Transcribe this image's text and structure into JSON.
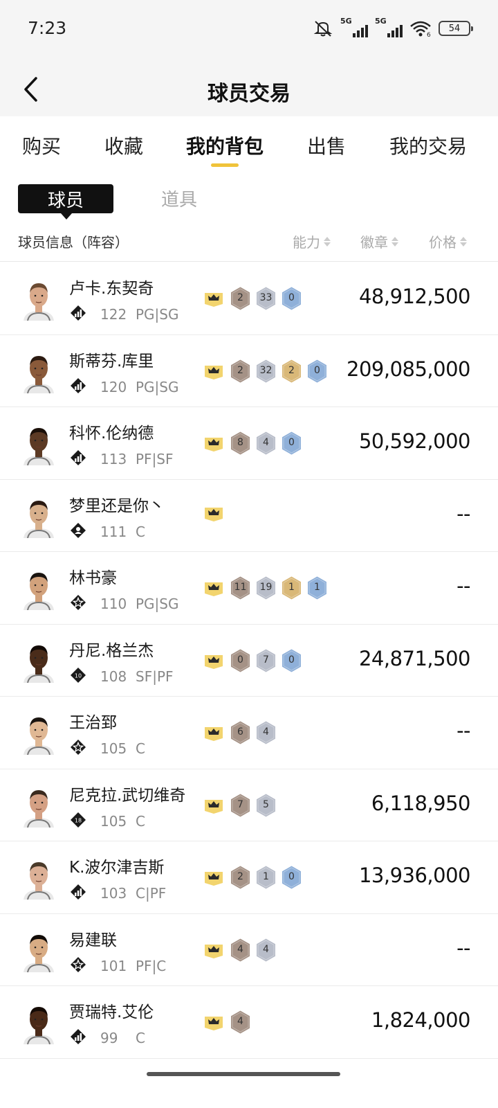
{
  "status": {
    "time": "7:23",
    "signal1": "5G",
    "signal2": "5G",
    "wifi_sub": "6",
    "battery": "54"
  },
  "header": {
    "title": "球员交易"
  },
  "tabs": [
    {
      "label": "购买"
    },
    {
      "label": "收藏"
    },
    {
      "label": "我的背包",
      "active": true
    },
    {
      "label": "出售"
    },
    {
      "label": "我的交易"
    }
  ],
  "subtabs": {
    "active": "球员",
    "other": "道具"
  },
  "columns": {
    "info": "球员信息（阵容）",
    "ability": "能力",
    "badge": "徽章",
    "price": "价格"
  },
  "colors": {
    "accent": "#f0c33a",
    "bronze": "#a59286",
    "silver": "#b8bdc9",
    "gold": "#d9b878",
    "blue": "#8fb0d9",
    "crown": "#f2d46e"
  },
  "players": [
    {
      "name": "卢卡.东契奇",
      "tier_icon": "bars-icon",
      "rating": "122",
      "position": "PG|SG",
      "skin": "#d9a98a",
      "hair": "#6b4a32",
      "badges": [
        {
          "type": "bronze",
          "value": "2"
        },
        {
          "type": "silver",
          "value": "33"
        },
        {
          "type": "blue",
          "value": "0"
        }
      ],
      "price": "48,912,500"
    },
    {
      "name": "斯蒂芬.库里",
      "tier_icon": "bars-icon",
      "rating": "120",
      "position": "PG|SG",
      "skin": "#8a5a3a",
      "hair": "#2b1a10",
      "badges": [
        {
          "type": "bronze",
          "value": "2"
        },
        {
          "type": "silver",
          "value": "32"
        },
        {
          "type": "gold",
          "value": "2"
        },
        {
          "type": "blue",
          "value": "0"
        }
      ],
      "price": "209,085,000"
    },
    {
      "name": "科怀.伦纳德",
      "tier_icon": "bars-icon",
      "rating": "113",
      "position": "PF|SF",
      "skin": "#5c3a24",
      "hair": "#1a0f08",
      "badges": [
        {
          "type": "bronze",
          "value": "8"
        },
        {
          "type": "silver",
          "value": "4"
        },
        {
          "type": "blue",
          "value": "0"
        }
      ],
      "price": "50,592,000"
    },
    {
      "name": "梦里还是你丶",
      "tier_icon": "person-icon",
      "rating": "111",
      "position": "C",
      "skin": "#d8b08c",
      "hair": "#2a1a12",
      "badges": [],
      "price": "--"
    },
    {
      "name": "林书豪",
      "tier_icon": "star-icon",
      "rating": "110",
      "position": "PG|SG",
      "skin": "#d2a27c",
      "hair": "#1a1410",
      "badges": [
        {
          "type": "bronze",
          "value": "11"
        },
        {
          "type": "silver",
          "value": "19"
        },
        {
          "type": "gold",
          "value": "1"
        },
        {
          "type": "blue",
          "value": "1"
        }
      ],
      "price": "--"
    },
    {
      "name": "丹尼.格兰杰",
      "tier_icon": "ten-icon",
      "rating": "108",
      "position": "SF|PF",
      "skin": "#4a2c1a",
      "hair": "#120a06",
      "badges": [
        {
          "type": "bronze",
          "value": "0"
        },
        {
          "type": "silver",
          "value": "7"
        },
        {
          "type": "blue",
          "value": "0"
        }
      ],
      "price": "24,871,500"
    },
    {
      "name": "王治郅",
      "tier_icon": "star-icon",
      "rating": "105",
      "position": "C",
      "skin": "#e0b894",
      "hair": "#1a1410",
      "badges": [
        {
          "type": "bronze",
          "value": "6"
        },
        {
          "type": "silver",
          "value": "4"
        }
      ],
      "price": "--"
    },
    {
      "name": "尼克拉.武切维奇",
      "tier_icon": "eighteen-icon",
      "rating": "105",
      "position": "C",
      "skin": "#d4a084",
      "hair": "#3a2a1e",
      "badges": [
        {
          "type": "bronze",
          "value": "7"
        },
        {
          "type": "silver",
          "value": "5"
        }
      ],
      "price": "6,118,950"
    },
    {
      "name": "K.波尔津吉斯",
      "tier_icon": "bars-icon",
      "rating": "103",
      "position": "C|PF",
      "skin": "#dcb096",
      "hair": "#4a3a2a",
      "badges": [
        {
          "type": "bronze",
          "value": "2"
        },
        {
          "type": "silver",
          "value": "1"
        },
        {
          "type": "blue",
          "value": "0"
        }
      ],
      "price": "13,936,000"
    },
    {
      "name": "易建联",
      "tier_icon": "star-icon",
      "rating": "101",
      "position": "PF|C",
      "skin": "#d8ac84",
      "hair": "#120c08",
      "badges": [
        {
          "type": "bronze",
          "value": "4"
        },
        {
          "type": "silver",
          "value": "4"
        }
      ],
      "price": "--"
    },
    {
      "name": "贾瑞特.艾伦",
      "tier_icon": "bars-icon",
      "rating": "99",
      "position": "C",
      "skin": "#4a2a18",
      "hair": "#140a05",
      "badges": [
        {
          "type": "bronze",
          "value": "4"
        }
      ],
      "price": "1,824,000"
    }
  ]
}
